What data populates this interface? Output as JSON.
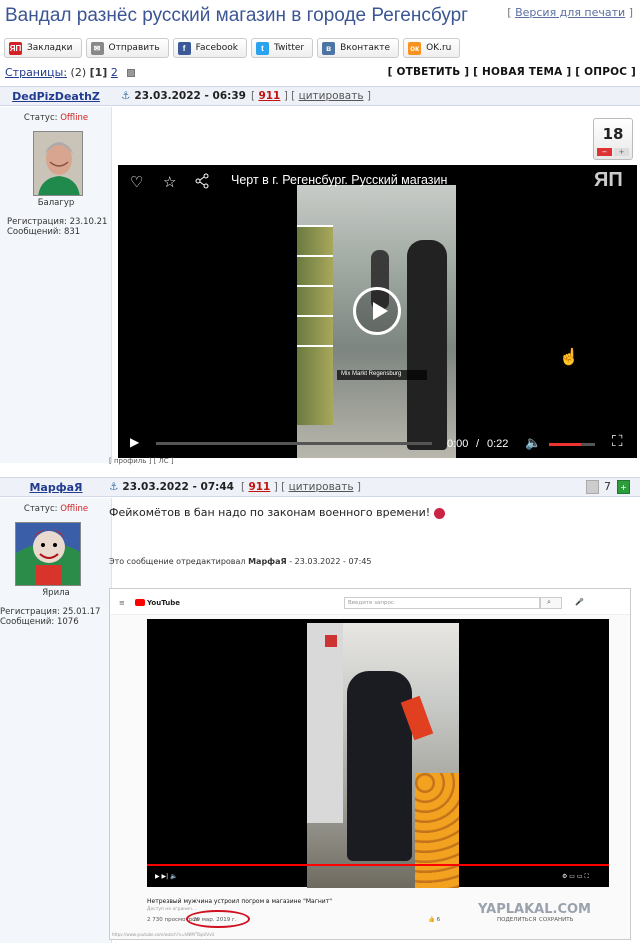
{
  "header": {
    "title": "Вандал разнёс русский магазин в городе Регенсбург",
    "print_label": "Версия для печати"
  },
  "share": [
    {
      "label": "Закладки",
      "icon": "yap-icon",
      "color": "#d42027",
      "glyph": "ЯП"
    },
    {
      "label": "Отправить",
      "icon": "mail-icon",
      "color": "#888888",
      "glyph": "✉"
    },
    {
      "label": "Facebook",
      "icon": "facebook-icon",
      "color": "#3b5998",
      "glyph": "f"
    },
    {
      "label": "Twitter",
      "icon": "twitter-icon",
      "color": "#2aa3ef",
      "glyph": "t"
    },
    {
      "label": "Вконтакте",
      "icon": "vk-icon",
      "color": "#4c75a3",
      "glyph": "в"
    },
    {
      "label": "OK.ru",
      "icon": "ok-icon",
      "color": "#f7931e",
      "glyph": "ок"
    }
  ],
  "pagination": {
    "label": "Страницы:",
    "count": "(2)",
    "current": "[1]",
    "next": "2"
  },
  "actions": {
    "reply": "ОТВЕТИТЬ",
    "new_topic": "НОВАЯ ТЕМА",
    "poll": "ОПРОС"
  },
  "post1": {
    "user": "DedPizDeathZ",
    "date": "23.03.2022 - 06:39",
    "num": "911",
    "quote": "цитировать",
    "status_label": "Статус:",
    "status": "Offline",
    "rank": "Балагур",
    "reg": "Регистрация: 23.10.21",
    "messages": "Сообщений: 831",
    "rating": "18",
    "rating_minus": "−",
    "rating_plus": "+",
    "video": {
      "title": "Черт в г. Регенсбург. Русский магазин",
      "logo": "ЯП",
      "overlay": "Mix Markt Regensburg",
      "time_current": "0:00",
      "time_sep": "/",
      "time_total": "0:22",
      "progress": 0.0,
      "volume": 0.7
    },
    "footer_links": "[ профиль ] [ ЛС ]"
  },
  "post2": {
    "user": "МарфаЯ",
    "date": "23.03.2022 - 07:44",
    "num": "911",
    "quote": "цитировать",
    "status_label": "Статус:",
    "status": "Offline",
    "rank": "Ярила",
    "reg": "Регистрация: 25.01.17",
    "messages": "Сообщений: 1076",
    "votes": "7",
    "text": "Фейкомётов в бан надо по законам военного времени!",
    "edited_prefix": "Это сообщение отредактировал ",
    "edited_user": "МарфаЯ",
    "edited_suffix": " - 23.03.2022 - 07:45",
    "yt": {
      "logo": "YouTube",
      "search_placeholder": "Введите запрос",
      "video_title": "Нетрезвый мужчина устроил погром в магазине \"Магнит\"",
      "views": "2 730 просмотров",
      "date": "29 мар. 2019 г.",
      "likes": "6",
      "share": "ПОДЕЛИТЬСЯ",
      "save": "СОХРАНИТЬ",
      "url": "https://www.youtube.com/watch?v=hNMYTbpUVvU",
      "channel": "Доступ не огранич..."
    },
    "watermark": "YAPLAKAL.COM"
  }
}
